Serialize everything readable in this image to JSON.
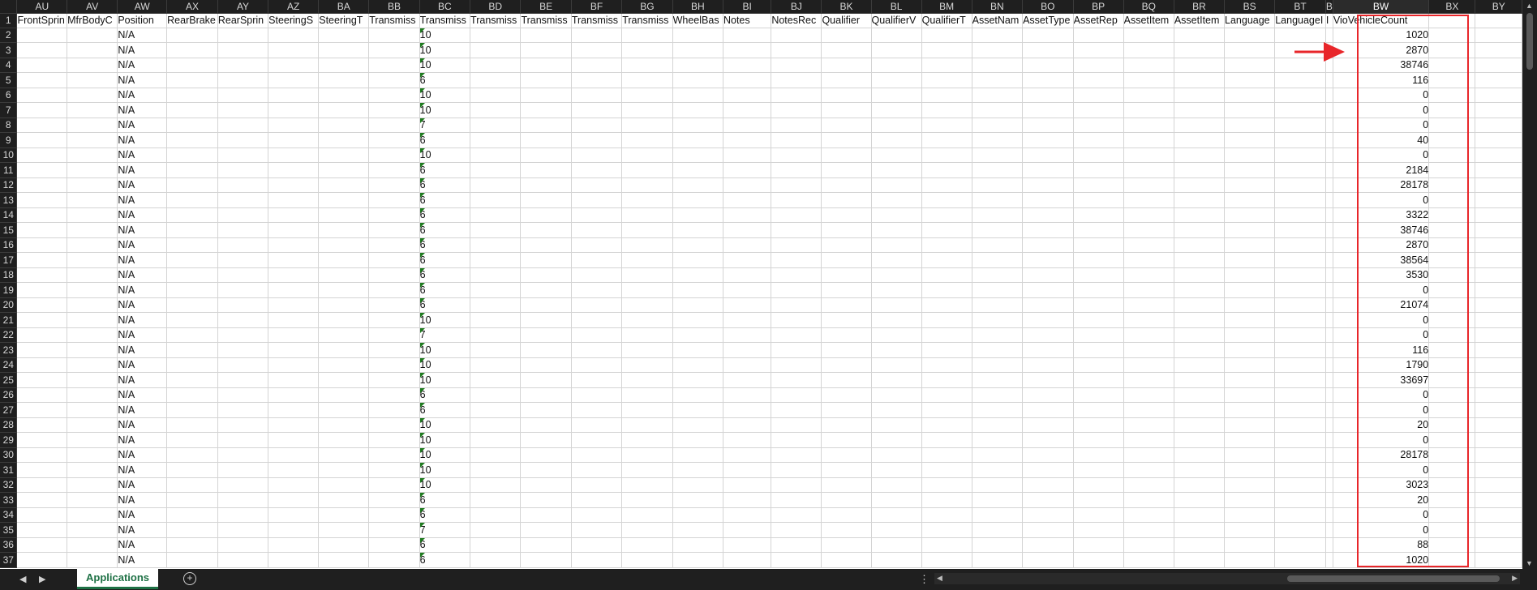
{
  "columns": [
    "AU",
    "AV",
    "AW",
    "AX",
    "AY",
    "AZ",
    "BA",
    "BB",
    "BC",
    "BD",
    "BE",
    "BF",
    "BG",
    "BH",
    "BI",
    "BJ",
    "BK",
    "BL",
    "BM",
    "BN",
    "BO",
    "BP",
    "BQ",
    "BR",
    "BS",
    "BT",
    "B",
    "BW",
    "BX",
    "BY"
  ],
  "header_row": [
    "FrontSprin",
    "MfrBodyC",
    "Position",
    "RearBrake",
    "RearSprin",
    "SteeringS",
    "SteeringT",
    "Transmiss",
    "Transmiss",
    "Transmiss",
    "Transmiss",
    "Transmiss",
    "Transmiss",
    "WheelBas",
    "Notes",
    "NotesRec",
    "Qualifier",
    "QualifierV",
    "QualifierT",
    "AssetNam",
    "AssetType",
    "AssetRep",
    "AssetItem",
    "AssetItem",
    "Language",
    "LanguageI",
    "I",
    "VioVehicleCount",
    "",
    ""
  ],
  "rows": [
    {
      "num": "2",
      "position": "N/A",
      "trans": "10",
      "vio": "1020"
    },
    {
      "num": "3",
      "position": "N/A",
      "trans": "10",
      "vio": "2870"
    },
    {
      "num": "4",
      "position": "N/A",
      "trans": "10",
      "vio": "38746"
    },
    {
      "num": "5",
      "position": "N/A",
      "trans": "6",
      "vio": "116"
    },
    {
      "num": "6",
      "position": "N/A",
      "trans": "10",
      "vio": "0"
    },
    {
      "num": "7",
      "position": "N/A",
      "trans": "10",
      "vio": "0"
    },
    {
      "num": "8",
      "position": "N/A",
      "trans": "7",
      "vio": "0"
    },
    {
      "num": "9",
      "position": "N/A",
      "trans": "6",
      "vio": "40"
    },
    {
      "num": "10",
      "position": "N/A",
      "trans": "10",
      "vio": "0"
    },
    {
      "num": "11",
      "position": "N/A",
      "trans": "6",
      "vio": "2184"
    },
    {
      "num": "12",
      "position": "N/A",
      "trans": "6",
      "vio": "28178"
    },
    {
      "num": "13",
      "position": "N/A",
      "trans": "6",
      "vio": "0"
    },
    {
      "num": "14",
      "position": "N/A",
      "trans": "6",
      "vio": "3322"
    },
    {
      "num": "15",
      "position": "N/A",
      "trans": "6",
      "vio": "38746"
    },
    {
      "num": "16",
      "position": "N/A",
      "trans": "6",
      "vio": "2870"
    },
    {
      "num": "17",
      "position": "N/A",
      "trans": "6",
      "vio": "38564"
    },
    {
      "num": "18",
      "position": "N/A",
      "trans": "6",
      "vio": "3530"
    },
    {
      "num": "19",
      "position": "N/A",
      "trans": "6",
      "vio": "0"
    },
    {
      "num": "20",
      "position": "N/A",
      "trans": "6",
      "vio": "21074"
    },
    {
      "num": "21",
      "position": "N/A",
      "trans": "10",
      "vio": "0"
    },
    {
      "num": "22",
      "position": "N/A",
      "trans": "7",
      "vio": "0"
    },
    {
      "num": "23",
      "position": "N/A",
      "trans": "10",
      "vio": "116"
    },
    {
      "num": "24",
      "position": "N/A",
      "trans": "10",
      "vio": "1790"
    },
    {
      "num": "25",
      "position": "N/A",
      "trans": "10",
      "vio": "33697"
    },
    {
      "num": "26",
      "position": "N/A",
      "trans": "6",
      "vio": "0"
    },
    {
      "num": "27",
      "position": "N/A",
      "trans": "6",
      "vio": "0"
    },
    {
      "num": "28",
      "position": "N/A",
      "trans": "10",
      "vio": "20"
    },
    {
      "num": "29",
      "position": "N/A",
      "trans": "10",
      "vio": "0"
    },
    {
      "num": "30",
      "position": "N/A",
      "trans": "10",
      "vio": "28178"
    },
    {
      "num": "31",
      "position": "N/A",
      "trans": "10",
      "vio": "0"
    },
    {
      "num": "32",
      "position": "N/A",
      "trans": "10",
      "vio": "3023"
    },
    {
      "num": "33",
      "position": "N/A",
      "trans": "6",
      "vio": "20"
    },
    {
      "num": "34",
      "position": "N/A",
      "trans": "6",
      "vio": "0"
    },
    {
      "num": "35",
      "position": "N/A",
      "trans": "7",
      "vio": "0"
    },
    {
      "num": "36",
      "position": "N/A",
      "trans": "6",
      "vio": "88"
    },
    {
      "num": "37",
      "position": "N/A",
      "trans": "6",
      "vio": "1020"
    }
  ],
  "sheet_tab": "Applications",
  "icons": {
    "nav_prev": "chevron-left-icon",
    "nav_next": "chevron-right-icon",
    "add_sheet": "plus-circle-icon",
    "options": "vertical-dots-icon"
  },
  "colors": {
    "highlight": "#e8262a",
    "tab_accent": "#1e7145",
    "error_triangle": "#1e7a1e"
  }
}
